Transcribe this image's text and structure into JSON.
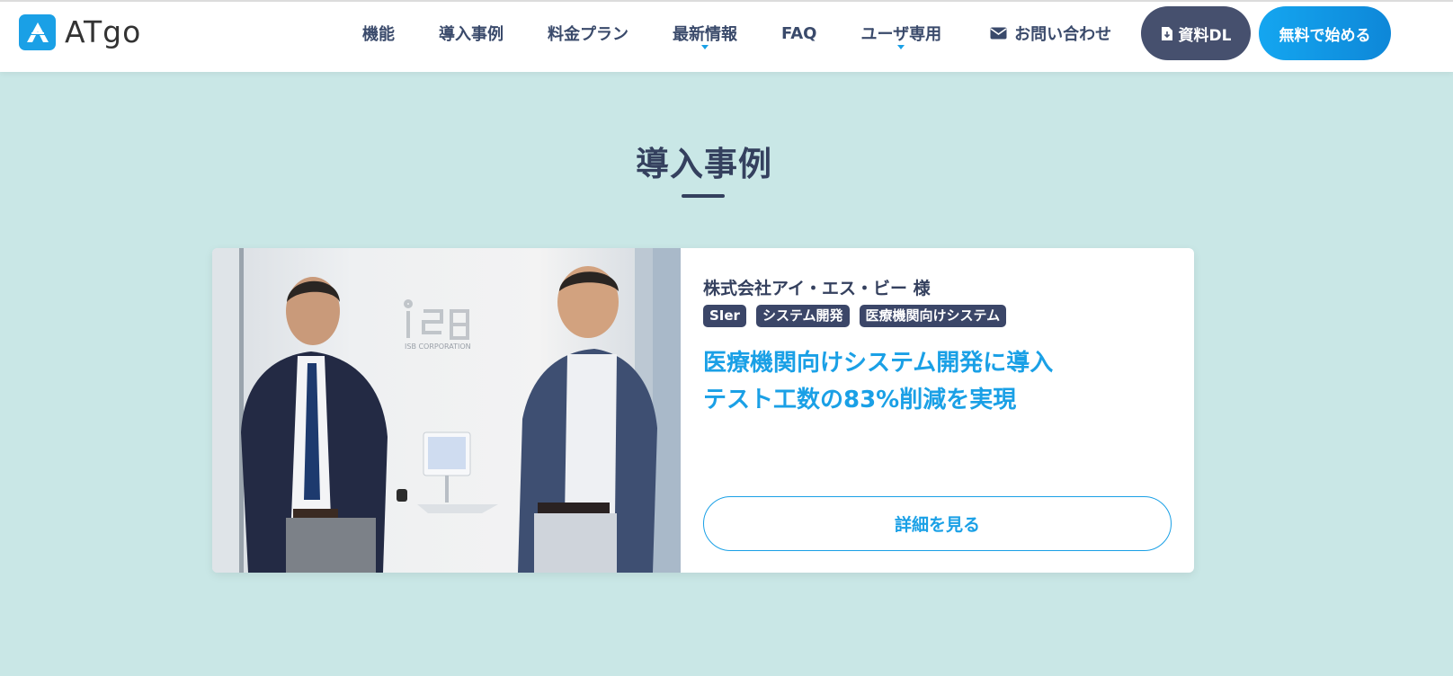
{
  "brand": {
    "logo_text": "ATgo",
    "accent": "#1aa0e6",
    "navy": "#46506e"
  },
  "nav": {
    "items": [
      {
        "label": "機能"
      },
      {
        "label": "導入事例"
      },
      {
        "label": "料金プラン"
      },
      {
        "label": "最新情報"
      },
      {
        "label": "FAQ"
      },
      {
        "label": "ユーザ専用"
      }
    ],
    "contact_label": "お問い合わせ",
    "download_label": "資料DL",
    "start_label": "無料で始める"
  },
  "section": {
    "title": "導入事例"
  },
  "case": {
    "company": "株式会社アイ・エス・ビー 様",
    "tags": [
      "SIer",
      "システム開発",
      "医療機関向けシステム"
    ],
    "headline_line1": "医療機関向けシステム開発に導入",
    "headline_line2": "テスト工数の83%削減を実現",
    "detail_label": "詳細を見る",
    "photo_sign_text": "ISB CORPORATION"
  }
}
